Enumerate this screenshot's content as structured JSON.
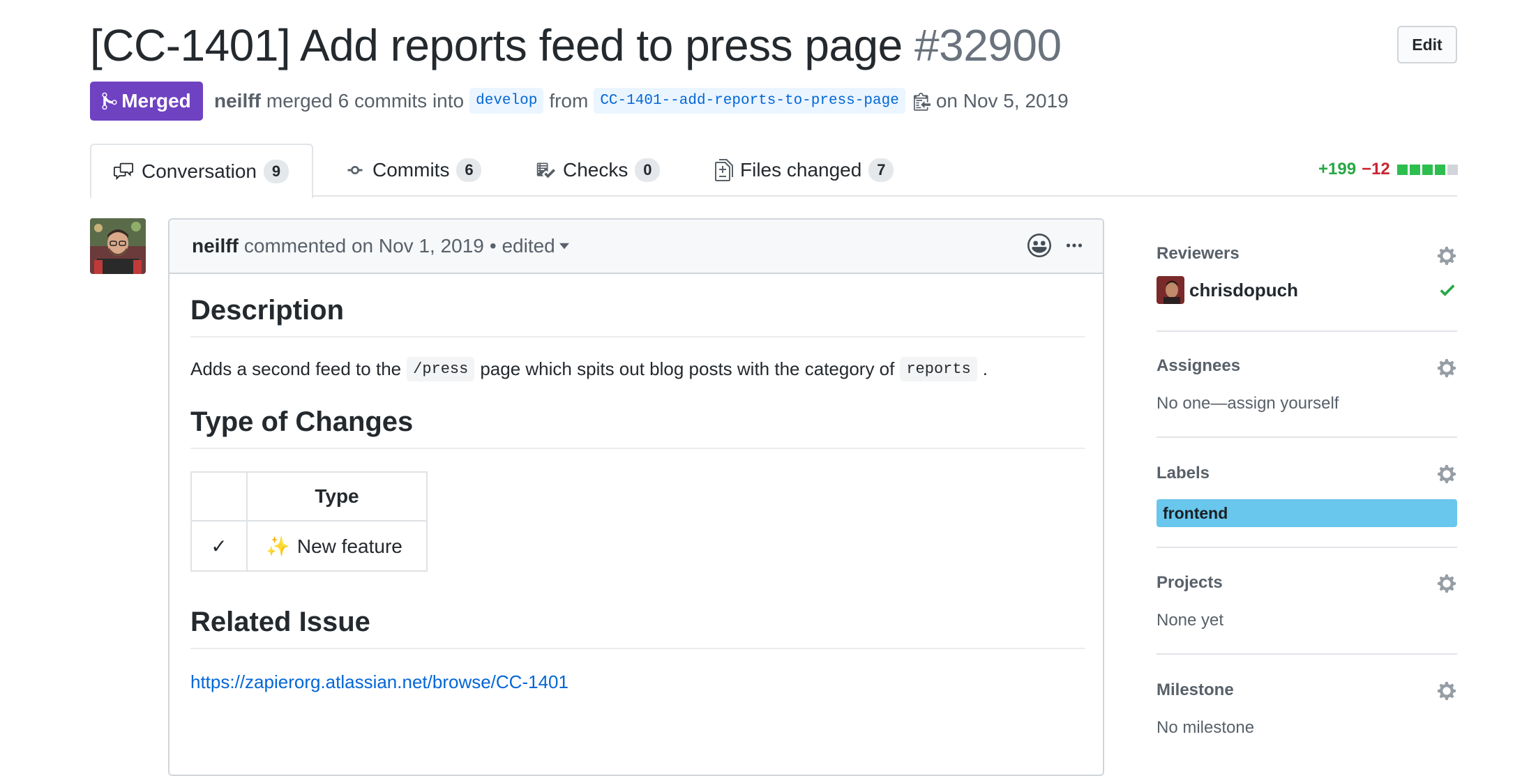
{
  "pr": {
    "title": "[CC-1401] Add reports feed to press page",
    "number": "#32900",
    "edit_label": "Edit",
    "status": "Merged",
    "author": "neilff",
    "merged_text": "merged 6 commits into",
    "base_branch": "develop",
    "from_text": "from",
    "head_branch": "CC-1401--add-reports-to-press-page",
    "date_text": "on Nov 5, 2019",
    "status_color": "#6f42c1"
  },
  "tabs": [
    {
      "label": "Conversation",
      "count": "9",
      "icon": "comment-discussion-icon"
    },
    {
      "label": "Commits",
      "count": "6",
      "icon": "git-commit-icon"
    },
    {
      "label": "Checks",
      "count": "0",
      "icon": "checklist-icon"
    },
    {
      "label": "Files changed",
      "count": "7",
      "icon": "diff-icon"
    }
  ],
  "diffstat": {
    "additions": "+199",
    "deletions": "−12",
    "blocks": [
      1,
      1,
      1,
      1,
      0
    ]
  },
  "comment": {
    "author": "neilff",
    "when": "commented on Nov 1, 2019",
    "edited": "• edited",
    "sections": {
      "description_heading": "Description",
      "description_text_1": "Adds a second feed to the",
      "description_code_1": "/press",
      "description_text_2": "page which spits out blog posts with the category of",
      "description_code_2": "reports",
      "description_text_3": ".",
      "changes_heading": "Type of Changes",
      "table_header": "Type",
      "table_check": "✓",
      "table_emoji": "✨",
      "table_value": "New feature",
      "related_heading": "Related Issue",
      "related_link": "https://zapierorg.atlassian.net/browse/CC-1401"
    }
  },
  "sidebar": {
    "reviewers": {
      "heading": "Reviewers",
      "name": "chrisdopuch",
      "approved_color": "#28a745"
    },
    "assignees": {
      "heading": "Assignees",
      "text": "No one—assign yourself"
    },
    "labels": {
      "heading": "Labels",
      "label": "frontend",
      "label_color": "#69c6ec"
    },
    "projects": {
      "heading": "Projects",
      "text": "None yet"
    },
    "milestone": {
      "heading": "Milestone",
      "text": "No milestone"
    }
  }
}
